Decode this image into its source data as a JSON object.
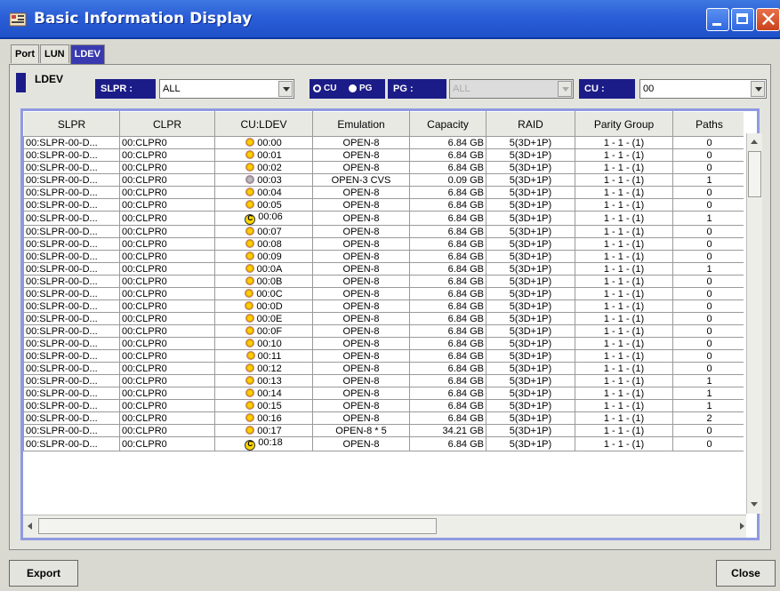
{
  "window": {
    "title": "Basic Information Display"
  },
  "tabs": [
    {
      "label": "Port",
      "active": false
    },
    {
      "label": "LUN",
      "active": false
    },
    {
      "label": "LDEV",
      "active": true
    }
  ],
  "filters": {
    "section_label": "LDEV",
    "slpr_label": "SLPR :",
    "slpr_value": "ALL",
    "radio_cu": "CU",
    "radio_pg": "PG",
    "selected_radio": "CU",
    "pg_label": "PG :",
    "pg_value": "ALL",
    "cu_label": "CU :",
    "cu_value": "00"
  },
  "table": {
    "columns": [
      "SLPR",
      "CLPR",
      "CU:LDEV",
      "Emulation",
      "Capacity",
      "RAID",
      "Parity Group",
      "Paths"
    ],
    "rows": [
      {
        "slpr": "00:SLPR-00-D...",
        "clpr": "00:CLPR0",
        "icon": "ldev-icon",
        "ldev": "00:00",
        "emulation": "OPEN-8",
        "capacity": "6.84 GB",
        "raid": "5(3D+1P)",
        "parity": "1 - 1 - (1)",
        "paths": "0"
      },
      {
        "slpr": "00:SLPR-00-D...",
        "clpr": "00:CLPR0",
        "icon": "ldev-icon",
        "ldev": "00:01",
        "emulation": "OPEN-8",
        "capacity": "6.84 GB",
        "raid": "5(3D+1P)",
        "parity": "1 - 1 - (1)",
        "paths": "0"
      },
      {
        "slpr": "00:SLPR-00-D...",
        "clpr": "00:CLPR0",
        "icon": "ldev-icon",
        "ldev": "00:02",
        "emulation": "OPEN-8",
        "capacity": "6.84 GB",
        "raid": "5(3D+1P)",
        "parity": "1 - 1 - (1)",
        "paths": "0"
      },
      {
        "slpr": "00:SLPR-00-D...",
        "clpr": "00:CLPR0",
        "icon": "ldev-cvs-icon",
        "ldev": "00:03",
        "emulation": "OPEN-3 CVS",
        "capacity": "0.09 GB",
        "raid": "5(3D+1P)",
        "parity": "1 - 1 - (1)",
        "paths": "1"
      },
      {
        "slpr": "00:SLPR-00-D...",
        "clpr": "00:CLPR0",
        "icon": "ldev-icon",
        "ldev": "00:04",
        "emulation": "OPEN-8",
        "capacity": "6.84 GB",
        "raid": "5(3D+1P)",
        "parity": "1 - 1 - (1)",
        "paths": "0"
      },
      {
        "slpr": "00:SLPR-00-D...",
        "clpr": "00:CLPR0",
        "icon": "ldev-icon",
        "ldev": "00:05",
        "emulation": "OPEN-8",
        "capacity": "6.84 GB",
        "raid": "5(3D+1P)",
        "parity": "1 - 1 - (1)",
        "paths": "0"
      },
      {
        "slpr": "00:SLPR-00-D...",
        "clpr": "00:CLPR0",
        "icon": "ldev-c-icon",
        "ldev": "00:06",
        "emulation": "OPEN-8",
        "capacity": "6.84 GB",
        "raid": "5(3D+1P)",
        "parity": "1 - 1 - (1)",
        "paths": "1"
      },
      {
        "slpr": "00:SLPR-00-D...",
        "clpr": "00:CLPR0",
        "icon": "ldev-icon",
        "ldev": "00:07",
        "emulation": "OPEN-8",
        "capacity": "6.84 GB",
        "raid": "5(3D+1P)",
        "parity": "1 - 1 - (1)",
        "paths": "0"
      },
      {
        "slpr": "00:SLPR-00-D...",
        "clpr": "00:CLPR0",
        "icon": "ldev-icon",
        "ldev": "00:08",
        "emulation": "OPEN-8",
        "capacity": "6.84 GB",
        "raid": "5(3D+1P)",
        "parity": "1 - 1 - (1)",
        "paths": "0"
      },
      {
        "slpr": "00:SLPR-00-D...",
        "clpr": "00:CLPR0",
        "icon": "ldev-icon",
        "ldev": "00:09",
        "emulation": "OPEN-8",
        "capacity": "6.84 GB",
        "raid": "5(3D+1P)",
        "parity": "1 - 1 - (1)",
        "paths": "0"
      },
      {
        "slpr": "00:SLPR-00-D...",
        "clpr": "00:CLPR0",
        "icon": "ldev-icon",
        "ldev": "00:0A",
        "emulation": "OPEN-8",
        "capacity": "6.84 GB",
        "raid": "5(3D+1P)",
        "parity": "1 - 1 - (1)",
        "paths": "1"
      },
      {
        "slpr": "00:SLPR-00-D...",
        "clpr": "00:CLPR0",
        "icon": "ldev-icon",
        "ldev": "00:0B",
        "emulation": "OPEN-8",
        "capacity": "6.84 GB",
        "raid": "5(3D+1P)",
        "parity": "1 - 1 - (1)",
        "paths": "0"
      },
      {
        "slpr": "00:SLPR-00-D...",
        "clpr": "00:CLPR0",
        "icon": "ldev-icon",
        "ldev": "00:0C",
        "emulation": "OPEN-8",
        "capacity": "6.84 GB",
        "raid": "5(3D+1P)",
        "parity": "1 - 1 - (1)",
        "paths": "0"
      },
      {
        "slpr": "00:SLPR-00-D...",
        "clpr": "00:CLPR0",
        "icon": "ldev-icon",
        "ldev": "00:0D",
        "emulation": "OPEN-8",
        "capacity": "6.84 GB",
        "raid": "5(3D+1P)",
        "parity": "1 - 1 - (1)",
        "paths": "0"
      },
      {
        "slpr": "00:SLPR-00-D...",
        "clpr": "00:CLPR0",
        "icon": "ldev-icon",
        "ldev": "00:0E",
        "emulation": "OPEN-8",
        "capacity": "6.84 GB",
        "raid": "5(3D+1P)",
        "parity": "1 - 1 - (1)",
        "paths": "0"
      },
      {
        "slpr": "00:SLPR-00-D...",
        "clpr": "00:CLPR0",
        "icon": "ldev-icon",
        "ldev": "00:0F",
        "emulation": "OPEN-8",
        "capacity": "6.84 GB",
        "raid": "5(3D+1P)",
        "parity": "1 - 1 - (1)",
        "paths": "0"
      },
      {
        "slpr": "00:SLPR-00-D...",
        "clpr": "00:CLPR0",
        "icon": "ldev-icon",
        "ldev": "00:10",
        "emulation": "OPEN-8",
        "capacity": "6.84 GB",
        "raid": "5(3D+1P)",
        "parity": "1 - 1 - (1)",
        "paths": "0"
      },
      {
        "slpr": "00:SLPR-00-D...",
        "clpr": "00:CLPR0",
        "icon": "ldev-icon",
        "ldev": "00:11",
        "emulation": "OPEN-8",
        "capacity": "6.84 GB",
        "raid": "5(3D+1P)",
        "parity": "1 - 1 - (1)",
        "paths": "0"
      },
      {
        "slpr": "00:SLPR-00-D...",
        "clpr": "00:CLPR0",
        "icon": "ldev-icon",
        "ldev": "00:12",
        "emulation": "OPEN-8",
        "capacity": "6.84 GB",
        "raid": "5(3D+1P)",
        "parity": "1 - 1 - (1)",
        "paths": "0"
      },
      {
        "slpr": "00:SLPR-00-D...",
        "clpr": "00:CLPR0",
        "icon": "ldev-icon",
        "ldev": "00:13",
        "emulation": "OPEN-8",
        "capacity": "6.84 GB",
        "raid": "5(3D+1P)",
        "parity": "1 - 1 - (1)",
        "paths": "1"
      },
      {
        "slpr": "00:SLPR-00-D...",
        "clpr": "00:CLPR0",
        "icon": "ldev-icon",
        "ldev": "00:14",
        "emulation": "OPEN-8",
        "capacity": "6.84 GB",
        "raid": "5(3D+1P)",
        "parity": "1 - 1 - (1)",
        "paths": "1"
      },
      {
        "slpr": "00:SLPR-00-D...",
        "clpr": "00:CLPR0",
        "icon": "ldev-icon",
        "ldev": "00:15",
        "emulation": "OPEN-8",
        "capacity": "6.84 GB",
        "raid": "5(3D+1P)",
        "parity": "1 - 1 - (1)",
        "paths": "1"
      },
      {
        "slpr": "00:SLPR-00-D...",
        "clpr": "00:CLPR0",
        "icon": "ldev-icon",
        "ldev": "00:16",
        "emulation": "OPEN-8",
        "capacity": "6.84 GB",
        "raid": "5(3D+1P)",
        "parity": "1 - 1 - (1)",
        "paths": "2"
      },
      {
        "slpr": "00:SLPR-00-D...",
        "clpr": "00:CLPR0",
        "icon": "ldev-luse-icon",
        "ldev": "00:17",
        "emulation": "OPEN-8 * 5",
        "capacity": "34.21 GB",
        "raid": "5(3D+1P)",
        "parity": "1 - 1 - (1)",
        "paths": "0"
      },
      {
        "slpr": "00:SLPR-00-D...",
        "clpr": "00:CLPR0",
        "icon": "ldev-c-icon",
        "ldev": "00:18",
        "emulation": "OPEN-8",
        "capacity": "6.84 GB",
        "raid": "5(3D+1P)",
        "parity": "1 - 1 - (1)",
        "paths": "0"
      }
    ]
  },
  "buttons": {
    "export": "Export",
    "close": "Close"
  },
  "colors": {
    "titlebar": "#2a5ed8",
    "label_bg": "#1c1c88",
    "active_tab": "#3a3ab0",
    "grid_border": "#8f9ae0"
  }
}
